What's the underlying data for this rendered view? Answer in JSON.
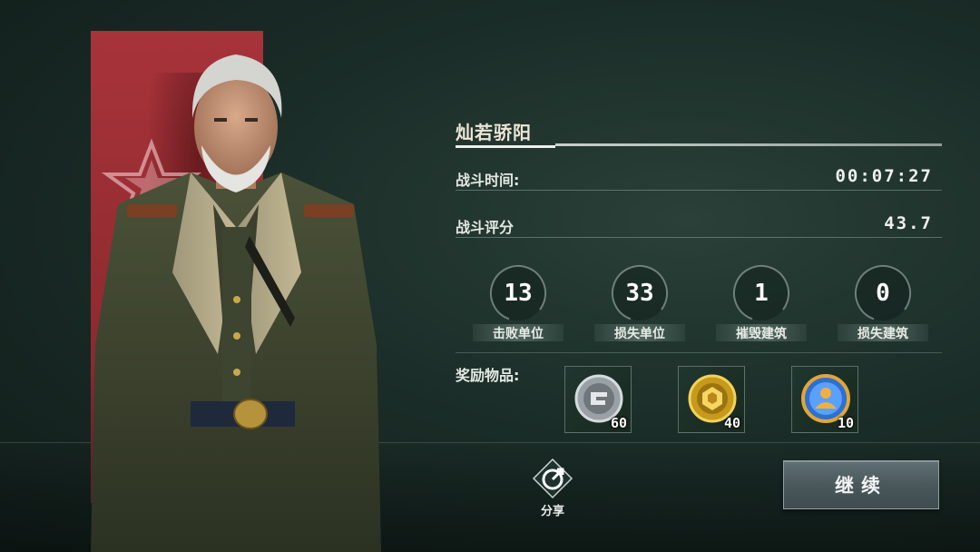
{
  "player": {
    "name": "灿若骄阳"
  },
  "battle": {
    "time_label": "战斗时间:",
    "time_value": "00:07:27",
    "score_label": "战斗评分",
    "score_value": "43.7"
  },
  "stats": [
    {
      "value": "13",
      "label": "击败单位"
    },
    {
      "value": "33",
      "label": "损失单位"
    },
    {
      "value": "1",
      "label": "摧毁建筑"
    },
    {
      "value": "0",
      "label": "损失建筑"
    }
  ],
  "rewards": {
    "label": "奖励物品:",
    "items": [
      {
        "icon": "silver-coin-icon",
        "quantity": "60"
      },
      {
        "icon": "gold-coin-icon",
        "quantity": "40"
      },
      {
        "icon": "commander-token-icon",
        "quantity": "10"
      }
    ]
  },
  "actions": {
    "share_label": "分享",
    "continue_label": "继续"
  },
  "colors": {
    "banner": "#a8333a",
    "background": "#1b2d28",
    "button": "#4a585c"
  }
}
